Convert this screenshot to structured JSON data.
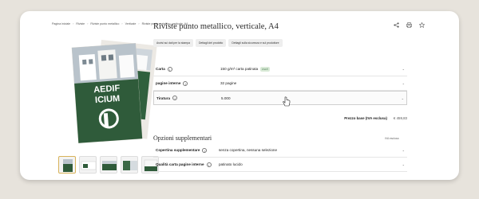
{
  "breadcrumb": [
    "Pagina iniziale",
    "Riviste",
    "Riviste punto metallico",
    "Verticale",
    "Riviste punto metallico, verticale, A4"
  ],
  "product": {
    "title": "Riviste punto metallico, verticale, A4",
    "cover_text_line1": "AEDIF",
    "cover_text_line2": "ICIUM"
  },
  "actions": {
    "share_icon": "share-icon",
    "print_icon": "print-icon",
    "favorite_icon": "star-icon"
  },
  "tabs": [
    "Avvisi sui dati per la stampa",
    "Dettagli del prodotto",
    "Dettagli sulla sicurezza e sul produttore"
  ],
  "options": [
    {
      "label": "Carta",
      "value": "150 g/m² carta patinata",
      "badge": "FSC®"
    },
    {
      "label": "pagine interne",
      "value": "32 pagine"
    },
    {
      "label": "Tiratura",
      "value": "5.000"
    }
  ],
  "price": {
    "label": "Prezzo base (IVA esclusa)",
    "value": "€ 459,83"
  },
  "extra": {
    "title": "Opzioni supplementari",
    "vat_note": "IVA esclusa",
    "rows": [
      {
        "label": "Copertina supplementare",
        "value": "senza copertina, nessuna selezione"
      },
      {
        "label": "Qualità carta pagine interne",
        "value": "patinato lucido"
      }
    ]
  },
  "colors": {
    "background": "#e7e3dc",
    "cover_green": "#2f5b3a",
    "thumb_active_border": "#d8b35a",
    "badge_bg": "#d9ead7"
  }
}
